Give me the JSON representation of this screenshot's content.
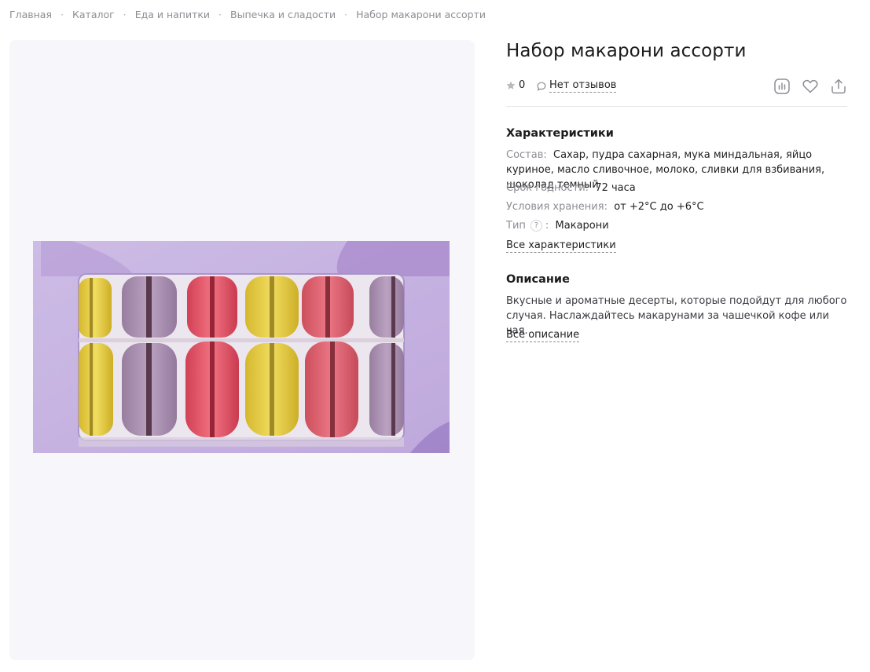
{
  "breadcrumbs": [
    {
      "label": "Главная"
    },
    {
      "label": "Каталог"
    },
    {
      "label": "Еда и напитки"
    },
    {
      "label": "Выпечка и сладости"
    },
    {
      "label": "Набор макарони ассорти"
    }
  ],
  "breadcrumb_separator": "·",
  "product": {
    "title": "Набор макарони ассорти",
    "rating": "0",
    "reviews_label": "Нет отзывов",
    "image_alt": "macarons-box-photo"
  },
  "actions": {
    "compare_icon": "compare-chart-icon",
    "favorite_icon": "heart-icon",
    "share_icon": "share-icon"
  },
  "characteristics": {
    "title": "Характеристики",
    "composition_label": "Состав",
    "composition_value": "Сахар, пудра сахарная, мука миндальная, яйцо куриное, масло сливочное, молоко, сливки для взбивания, шоколад темный",
    "shelf_life_label": "Срок годности",
    "shelf_life_value": "72 часа",
    "storage_label": "Условия хранения",
    "storage_value": "от +2°C до +6°C",
    "type_label": "Тип",
    "type_help": "?",
    "type_value": "Макарони",
    "all_link": "Все характеристики"
  },
  "description": {
    "title": "Описание",
    "text": "Вкусные и ароматные десерты, которые подойдут для любого случая. Наслаждайтесь макарунами за чашечкой кофе или чая.",
    "all_link": "Все описание"
  },
  "colors": {
    "box_lavender": "#c6b3e0",
    "macaron_yellow": "#e8cf3a",
    "macaron_purple": "#a98cb0",
    "macaron_red": "#e24a5e",
    "macaron_pink": "#e0566b"
  }
}
